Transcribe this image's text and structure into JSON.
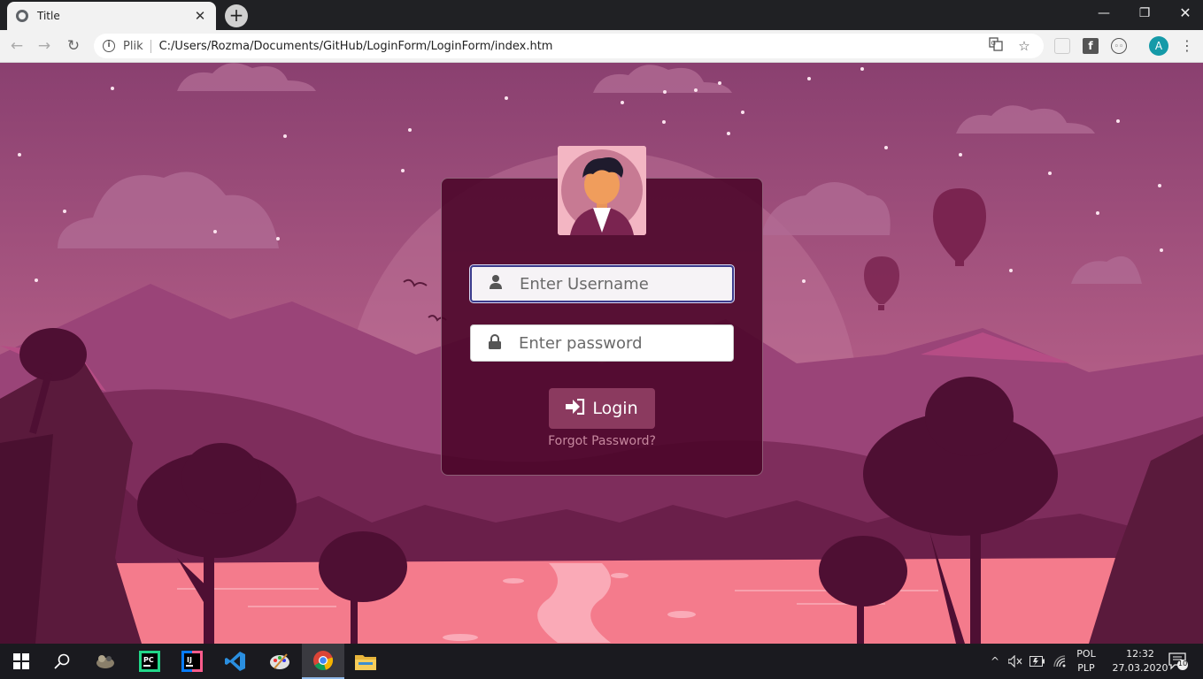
{
  "browser": {
    "tab_title": "Title",
    "tab_close": "✕",
    "new_tab": "+",
    "scheme_label": "Plik",
    "url": "C:/Users/Rozma/Documents/GitHub/LoginForm/LoginForm/index.htm",
    "profile_initial": "A"
  },
  "login": {
    "username_placeholder": "Enter Username",
    "password_placeholder": "Enter password",
    "login_label": "Login",
    "forgot_label": "Forgot Password?"
  },
  "taskbar": {
    "lang_top": "POL",
    "lang_bottom": "PLP",
    "time": "12:32",
    "date": "27.03.2020",
    "notification_count": "10"
  },
  "colors": {
    "sky": "#9a4a78",
    "card": "#4a0528",
    "button": "#8b3a5f",
    "lake": "#f47b8c",
    "forgot_link": "#c6879e"
  }
}
